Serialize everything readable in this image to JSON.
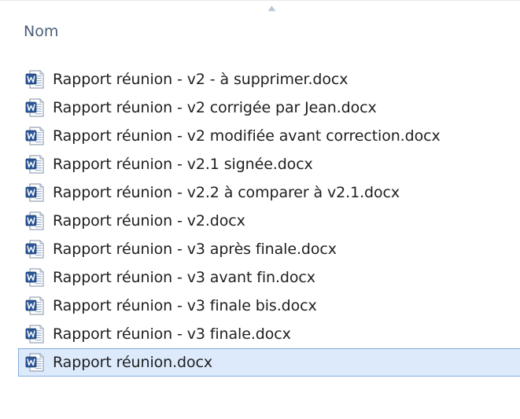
{
  "column_header": {
    "label": "Nom",
    "sort_indicator": "▲"
  },
  "files": [
    {
      "name": "Rapport réunion - v2 - à supprimer.docx",
      "icon": "word-document-icon",
      "selected": false
    },
    {
      "name": "Rapport réunion - v2 corrigée par Jean.docx",
      "icon": "word-document-icon",
      "selected": false
    },
    {
      "name": "Rapport réunion - v2 modifiée avant correction.docx",
      "icon": "word-document-icon",
      "selected": false
    },
    {
      "name": "Rapport réunion - v2.1 signée.docx",
      "icon": "word-document-icon",
      "selected": false
    },
    {
      "name": "Rapport réunion - v2.2 à comparer à v2.1.docx",
      "icon": "word-document-icon",
      "selected": false
    },
    {
      "name": "Rapport réunion - v2.docx",
      "icon": "word-document-icon",
      "selected": false
    },
    {
      "name": "Rapport réunion - v3 après finale.docx",
      "icon": "word-document-icon",
      "selected": false
    },
    {
      "name": "Rapport réunion - v3 avant fin.docx",
      "icon": "word-document-icon",
      "selected": false
    },
    {
      "name": "Rapport réunion - v3 finale bis.docx",
      "icon": "word-document-icon",
      "selected": false
    },
    {
      "name": "Rapport réunion - v3 finale.docx",
      "icon": "word-document-icon",
      "selected": false
    },
    {
      "name": "Rapport réunion.docx",
      "icon": "word-document-icon",
      "selected": true
    }
  ],
  "colors": {
    "selection_background": "#dceafc",
    "selection_border": "#84acdd",
    "header_text": "#4c607a",
    "word_blue": "#2b5797"
  }
}
